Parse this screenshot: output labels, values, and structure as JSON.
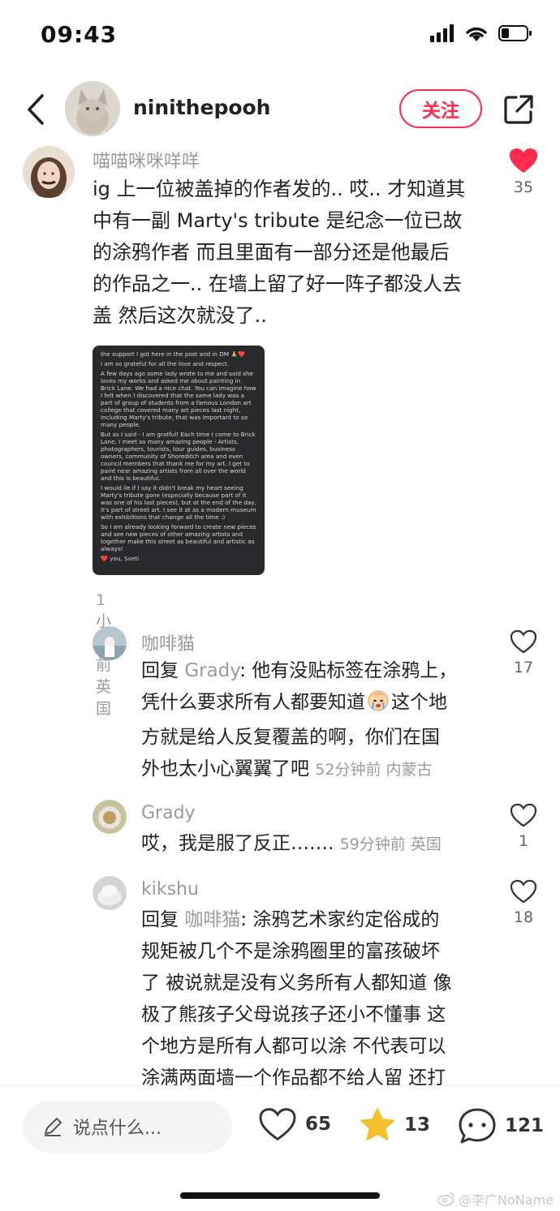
{
  "status_bar": {
    "time": "09:43"
  },
  "header": {
    "author_name": "ninithepooh",
    "follow_label": "关注"
  },
  "main_comment": {
    "user": "喵喵咪咪咩咩",
    "text_lines": [
      "ig 上一位被盖掉的作者发的.. 哎.. 才知道其",
      "中有一副 Marty's tribute 是纪念一位已故",
      "的涂鸦作者 而且里面有一部分还是他最后",
      "的作品之一.. 在墙上留了好一阵子都没人去",
      "盖 然后这次就没了.."
    ],
    "likes": "35",
    "meta": "1小时前 英国",
    "image_text": [
      "the support I got here in the post and in DM 🙏❤️",
      "I am so grateful for all the love and respect.",
      "A few days ago some lady wrote to me and said she loves my works and asked me about painting in Brick Lane. We had a nice chat. You can imagine how I felt when I discovered that the same lady was a part of group of students from a famous London art college that covered many art pieces last night, including Marty's tribute, that was important to so many people.",
      "But as I said - I am gratful! Each time I come to Brick Lane, I meet so many amazing people - Artists, photographers, tourists, tour guides, business owners, community of Shoreditch area and even council members that thank me for my art. I get to paint near amazing artists from all over the world and this is beautiful.",
      "I would lie if I say it didn't break my heart seeing Marty's tribute gone (especially because part of it was one of his last pieces), but at the end of the day, it's part of street art. I see it at as a modern museum with exhibitions that change all the time :)",
      "So I am already looking forward to create new pieces and see new pieces of other amazing artists and together make this street as beautiful and artistic as always!",
      "❤️ you, Sveti"
    ]
  },
  "replies": [
    {
      "user": "咖啡猫",
      "reply_prefix": "回复",
      "reply_to": "Grady",
      "text_lines": [
        ": 他有没贴标签在涂鸦上，",
        "凭什么要求所有人都要知道",
        "这个地",
        "方就是给人反复覆盖的啊，你们在国",
        "外也太小心翼翼了吧"
      ],
      "meta": "52分钟前 内蒙古",
      "likes": "17"
    },
    {
      "user": "Grady",
      "text_lines": [
        "哎，我是服了反正……."
      ],
      "meta": "59分钟前 英国",
      "likes": "1"
    },
    {
      "user": "kikshu",
      "reply_prefix": "回复",
      "reply_to": "咖啡猫",
      "text_lines": [
        ": 涂鸦艺术家约定俗成的",
        "规矩被几个不是涂鸦圈里的富孩破坏",
        "了 被说就是没有义务所有人都知道 像",
        "极了熊孩子父母说孩子还小不懂事 这",
        "个地方是所有人都可以涂 不代表可以",
        "涂满两面墙一个作品都不给人留 还打"
      ],
      "likes": "18"
    }
  ],
  "bottom_bar": {
    "input_placeholder": "说点什么...",
    "likes": "65",
    "stars": "13",
    "comments": "121"
  },
  "watermark": "@李广NoName",
  "colors": {
    "accent": "#ff2a4d",
    "muted": "#9a9a9a",
    "star": "#f5c02d"
  }
}
